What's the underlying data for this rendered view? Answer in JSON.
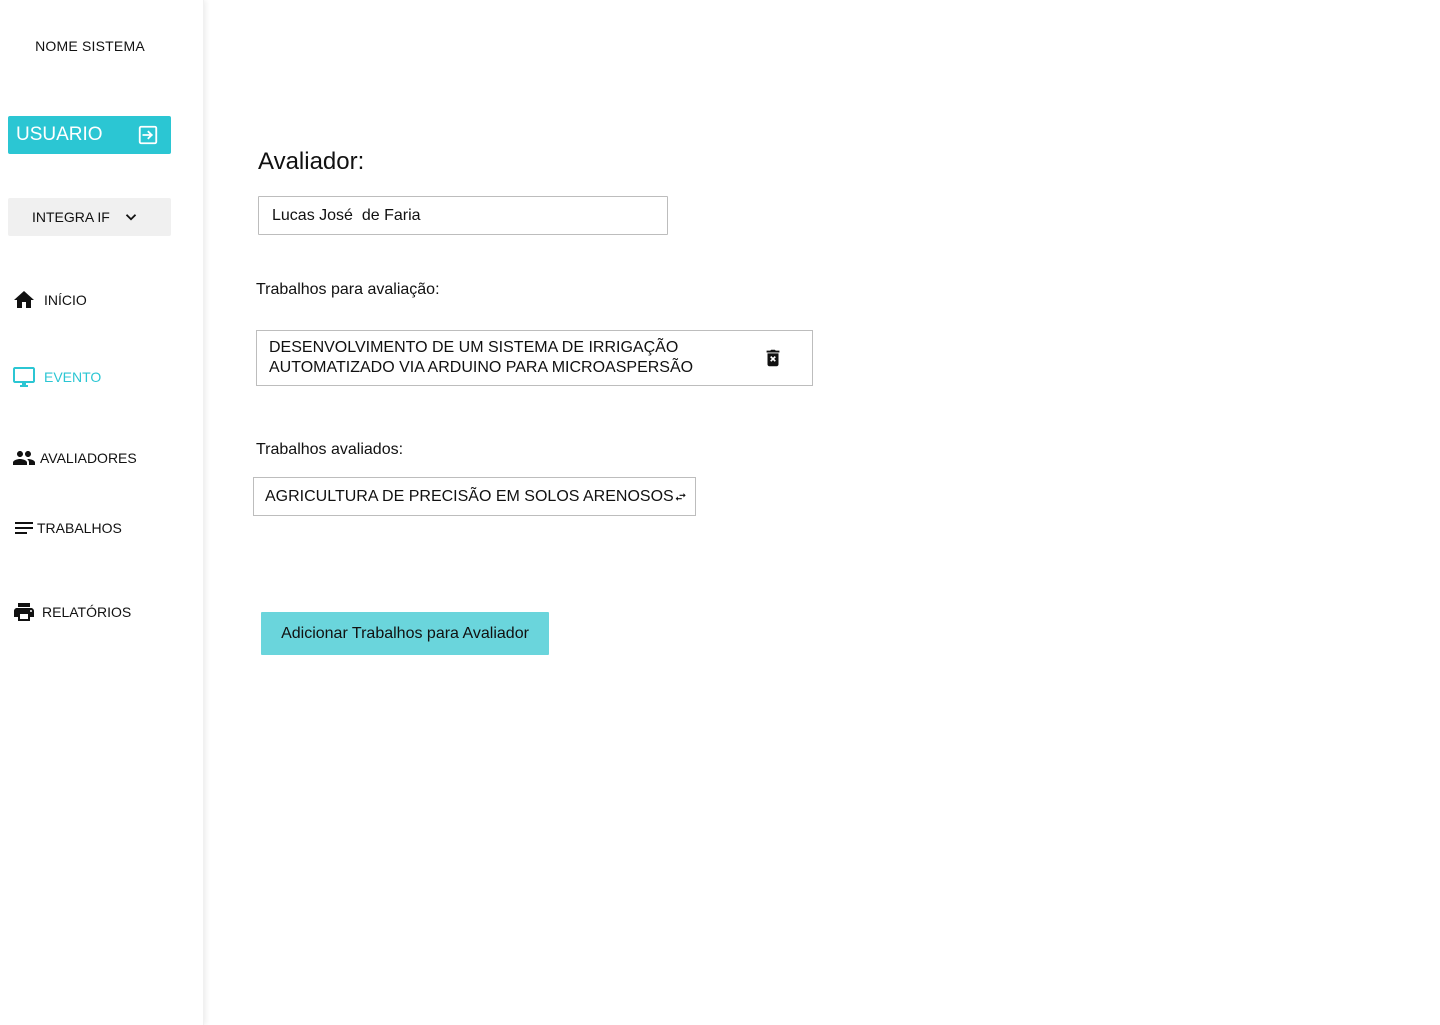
{
  "sidebar": {
    "app_title": "NOME SISTEMA",
    "user_button_label": "USUARIO",
    "org_select_value": "INTEGRA IF",
    "items": [
      {
        "label": "INÍCIO",
        "icon": "home-icon"
      },
      {
        "label": "EVENTO",
        "icon": "monitor-icon",
        "active": true
      },
      {
        "label": "AVALIADORES",
        "icon": "people-icon"
      },
      {
        "label": "TRABALHOS",
        "icon": "list-lines-icon"
      },
      {
        "label": "RELATÓRIOS",
        "icon": "printer-icon"
      }
    ]
  },
  "main": {
    "evaluator_title": "Avaliador:",
    "evaluator_value": "Lucas José  de Faria",
    "pending_label": "Trabalhos para avaliação:",
    "pending_items": [
      {
        "title": "DESENVOLVIMENTO DE UM SISTEMA DE IRRIGAÇÃO\nAUTOMATIZADO VIA ARDUINO PARA MICROASPERSÃO"
      }
    ],
    "evaluated_label": "Trabalhos avaliados:",
    "evaluated_items": [
      {
        "title": "AGRICULTURA DE PRECISÃO EM SOLOS ARENOSOS"
      }
    ],
    "add_button_label": "Adicionar Trabalhos para Avaliador"
  },
  "colors": {
    "accent": "#2bc6d3",
    "button_light": "#6ad5dc",
    "select_bg": "#f0f0f0",
    "border": "#bdbdbd"
  }
}
